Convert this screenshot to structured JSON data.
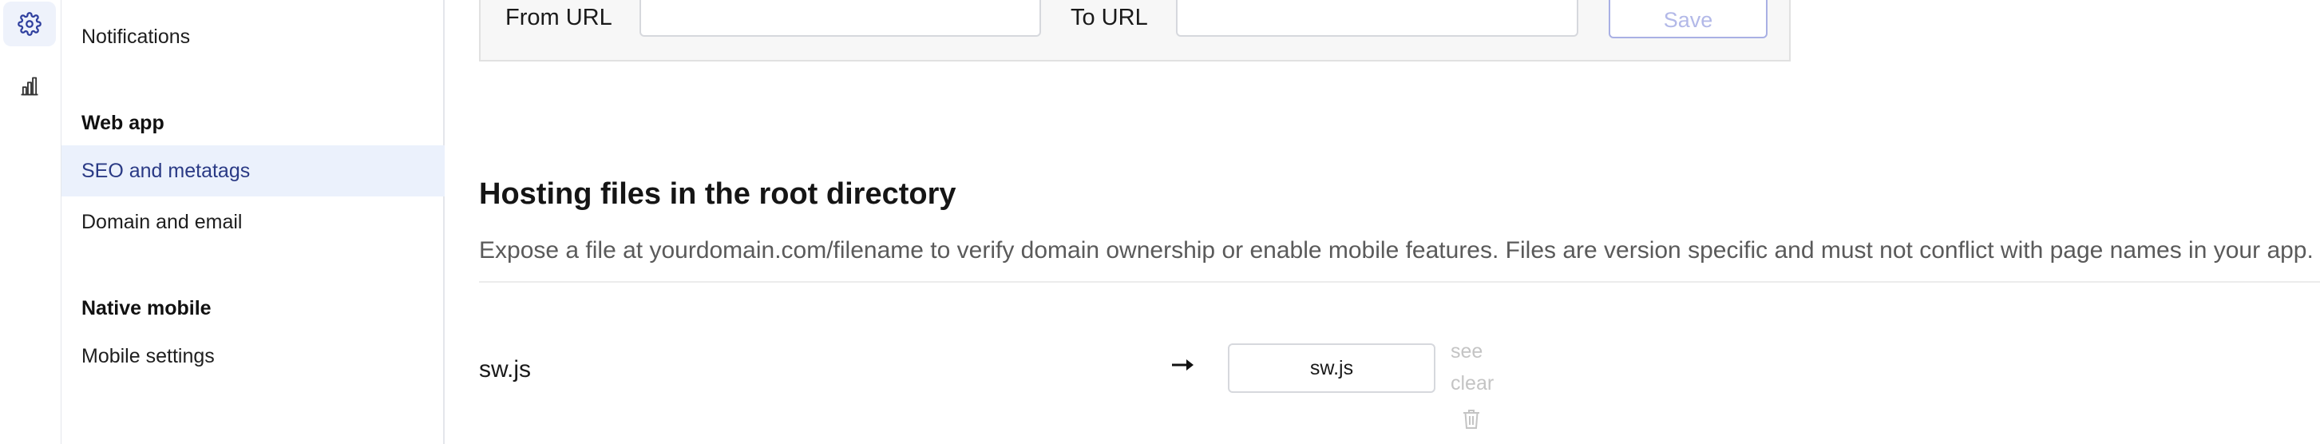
{
  "sidebar": {
    "items_top": [
      {
        "label": "Notifications"
      }
    ],
    "sections": [
      {
        "title": "Web app",
        "items": [
          {
            "label": "SEO and metatags",
            "active": true
          },
          {
            "label": "Domain and email"
          }
        ]
      },
      {
        "title": "Native mobile",
        "items": [
          {
            "label": "Mobile settings"
          }
        ]
      }
    ]
  },
  "redirect": {
    "from_label": "From URL",
    "to_label": "To URL",
    "save_label": "Save"
  },
  "hosting": {
    "title": "Hosting files in the root directory",
    "description": "Expose a file at yourdomain.com/filename to verify domain ownership or enable mobile features. Files are version specific and must not conflict with page names in your app.",
    "rows": [
      {
        "name": "sw.js",
        "file": "sw.js",
        "see_label": "see",
        "clear_label": "clear"
      }
    ]
  },
  "icons": {
    "rail": [
      "gear-icon",
      "chart-icon"
    ],
    "row": [
      "arrow-right-icon",
      "trash-icon"
    ]
  },
  "colors": {
    "active_bg": "#ebf1fc",
    "active_text": "#2a3a85",
    "save_border": "#a9b0e4"
  }
}
